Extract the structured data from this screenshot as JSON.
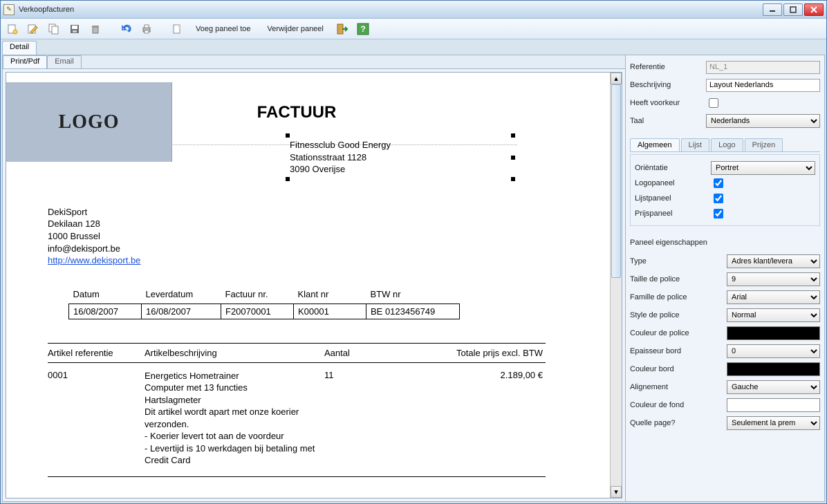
{
  "window": {
    "title": "Verkoopfacturen"
  },
  "toolbar": {
    "add_panel": "Voeg paneel toe",
    "remove_panel": "Verwijder paneel"
  },
  "outerTabs": [
    "Detail"
  ],
  "innerTabs": [
    "Print/Pdf",
    "Email"
  ],
  "invoice": {
    "logo_text": "LOGO",
    "title": "FACTUUR",
    "recipient": {
      "name": "Fitnessclub Good Energy",
      "street": "Stationsstraat 1128",
      "city": "3090 Overijse"
    },
    "sender": {
      "name": "DekiSport",
      "street": "Dekilaan 128",
      "city": "1000 Brussel",
      "email": "info@dekisport.be",
      "website": "http://www.dekisport.be"
    },
    "info_headers": [
      "Datum",
      "Leverdatum",
      "Factuur nr.",
      "Klant nr",
      "BTW nr"
    ],
    "info_values": [
      "16/08/2007",
      "16/08/2007",
      "F20070001",
      "K00001",
      "BE 0123456749"
    ],
    "cols": {
      "ref": "Artikel referentie",
      "desc": "Artikelbeschrijving",
      "qty": "Aantal",
      "total": "Totale prijs excl. BTW"
    },
    "line": {
      "ref": "0001",
      "desc": "Energetics Hometrainer\nComputer met 13 functies\nHartslagmeter\nDit artikel wordt apart met onze koerier verzonden.\n- Koerier levert tot aan de voordeur\n- Levertijd is 10 werkdagen bij betaling met Credit Card",
      "qty": "11",
      "total": "2.189,00 €"
    }
  },
  "right": {
    "labels": {
      "reference": "Referentie",
      "description": "Beschrijving",
      "preferred": "Heeft voorkeur",
      "language": "Taal"
    },
    "values": {
      "reference": "NL_1",
      "description": "Layout Nederlands",
      "preferred": false,
      "language": "Nederlands"
    },
    "tabs": [
      "Algemeen",
      "Lijst",
      "Logo",
      "Prijzen"
    ],
    "general": {
      "orientation_label": "Oriëntatie",
      "orientation": "Portret",
      "logopanel_label": "Logopaneel",
      "logopanel": true,
      "listpanel_label": "Lijstpaneel",
      "listpanel": true,
      "pricepanel_label": "Prijspaneel",
      "pricepanel": true
    },
    "panel_section_title": "Paneel eigenschappen",
    "panel": {
      "type_label": "Type",
      "type": "Adres klant/levera",
      "font_size_label": "Taille de police",
      "font_size": "9",
      "font_family_label": "Famille de police",
      "font_family": "Arial",
      "font_style_label": "Style de police",
      "font_style": "Normal",
      "font_color_label": "Couleur de police",
      "border_width_label": "Epaisseur bord",
      "border_width": "0",
      "border_color_label": "Couleur bord",
      "align_label": "Alignement",
      "align": "Gauche",
      "bg_color_label": "Couleur de fond",
      "page_label": "Quelle page?",
      "page": "Seulement la prem"
    }
  }
}
